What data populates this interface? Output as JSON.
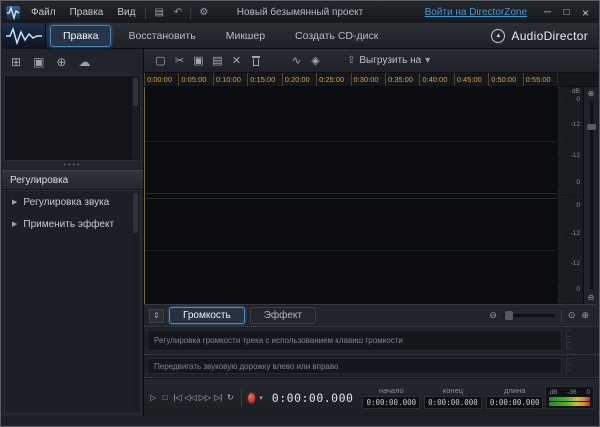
{
  "titlebar": {
    "menus": [
      "Файл",
      "Правка",
      "Вид"
    ],
    "project_title": "Новый безымянный проект",
    "directorzone_link": "Войти на DirectorZone",
    "minimize": "─",
    "maximize": "□",
    "close": "×"
  },
  "tabbar": {
    "tabs": [
      "Правка",
      "Восстановить",
      "Микшер",
      "Создать CD-диск"
    ],
    "brand": "AudioDirector"
  },
  "sidebar": {
    "panel_title": "Регулировка",
    "item_arrow": "▶",
    "items": [
      "Регулировка звука",
      "Применить эффект"
    ]
  },
  "icons": {
    "save": "▤",
    "undo": "↶",
    "gear": "⚙",
    "import_file": "⊞",
    "import_library": "▣",
    "directorzone_globe": "⊕",
    "cloud": "☁",
    "brand_mark": "▲",
    "trim": "▢",
    "cut": "✂",
    "copy": "▣",
    "paste": "▤",
    "delete": "✕",
    "wave": "∿",
    "marker": "◈",
    "upload_arrow": "⇧",
    "chevron": "▾",
    "collapse": "⇕",
    "zoom_out": "⊖",
    "zoom_in": "⊕",
    "zoom_fit": "⊙"
  },
  "toolbar": {
    "upload_label": "Выгрузить на"
  },
  "timeline": {
    "ticks": [
      "0:00:00",
      "0:05:00",
      "0:10:00",
      "0:15:00",
      "0:20:00",
      "0:25:00",
      "0:30:00",
      "0:35:00",
      "0:40:00",
      "0:45:00",
      "0:50:00",
      "0:55:00"
    ],
    "db_header": "dB",
    "db_labels": [
      "0",
      "-12",
      "-12",
      "0"
    ]
  },
  "bottom_panel": {
    "tabs": [
      "Громкость",
      "Эффект"
    ],
    "track1_label": "Регулировка громкости трека с использованием клавиш громкости",
    "track2_label": "Передвигать звуковую дорожку влево или вправо"
  },
  "transport": {
    "play": "▷",
    "stop": "□",
    "to_start": "|◁",
    "step_back": "◁◁",
    "step_forward": "▷▷",
    "to_end": "▷|",
    "loop": "↻",
    "record_chevron": "▾",
    "time": "0:00:00.000",
    "fields": [
      {
        "label": "начало",
        "value": "0:00:00.000"
      },
      {
        "label": "конец",
        "value": "0:00:00.000"
      },
      {
        "label": "длина",
        "value": "0:00:00.000"
      }
    ],
    "meter": {
      "db": "dB",
      "min": "-36",
      "max": "0"
    }
  }
}
